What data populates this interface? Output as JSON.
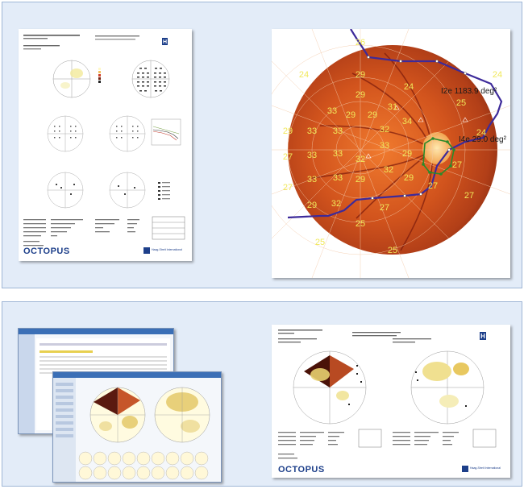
{
  "report1": {
    "header_lines": [
      "Doe, John, 01.01.1970, male, Caucasian / White",
      "ID 987-654-321",
      "OS 19.06.2007 12:44:25",
      "Sound in Clay"
    ],
    "hospital_small": "International EyeCare Hospital",
    "hospital_small2": "Musterstrasse, Bern, Switzerland",
    "hospital_logo_top": "INTERNATIONAL",
    "hospital_logo_bottom": "HOSPITAL",
    "map_titles": [
      "Comparison (GCT)",
      "Values",
      "Comparison",
      "Corrected comparison",
      "Defect curve",
      "Probabilities",
      "Corrected probabilities"
    ],
    "brand": "OCTOPUS",
    "brand_sub": "Haag-Streit International",
    "footer_line": "EyeSuite™ Static perimetry V1.3.1 · OCTOPUS 900, SN 1782 & 1.18.5"
  },
  "goldmann": {
    "labels": [
      "I2e  1183.9 deg²",
      "I4e  29.0 deg²"
    ],
    "values": [
      "29",
      "29",
      "33",
      "29",
      "29",
      "24",
      "31",
      "33",
      "29",
      "33",
      "25",
      "33",
      "33",
      "32",
      "32",
      "33",
      "34",
      "29",
      "27",
      "33",
      "32",
      "29",
      "27",
      "33",
      "29",
      "27",
      "27",
      "29",
      "32",
      "24",
      "25",
      "27",
      "25",
      "27",
      "25",
      "24",
      "26",
      "24"
    ]
  },
  "software": {
    "title_bar": "Octopus Perimetry – EyeSuite"
  },
  "report2": {
    "header_lines": [
      "Trend, Sue, 01.01.1956, female",
      "ID 0003",
      "OD 23.01.2008 10:43:22",
      "Comparison (GCT)"
    ],
    "right_header": "OS 23.01.2008 10:13:26",
    "hospital_logo_top": "INTERNATIONAL",
    "hospital_logo_bottom": "HOSPITAL",
    "brand": "OCTOPUS",
    "brand_sub": "Haag-Streit International"
  }
}
